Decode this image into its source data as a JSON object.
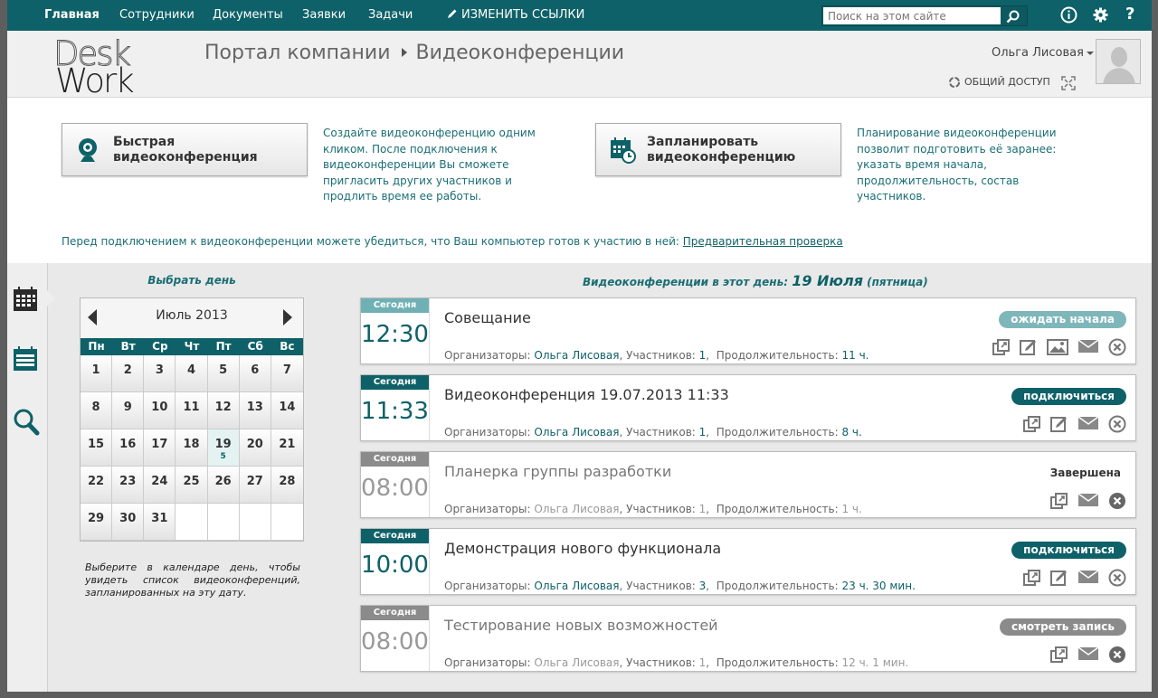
{
  "topnav": {
    "items": [
      "Главная",
      "Сотрудники",
      "Документы",
      "Заявки",
      "Задачи"
    ],
    "edit_links": "ИЗМЕНИТЬ ССЫЛКИ",
    "search_placeholder": "Поиск на этом сайте"
  },
  "header": {
    "logo_line1": "Desk",
    "logo_line2": "Work",
    "breadcrumb": [
      "Портал компании",
      "Видеоконференции"
    ],
    "user_name": "Ольга Лисовая",
    "share_label": "ОБЩИЙ ДОСТУП"
  },
  "actions": {
    "quick": {
      "label": "Быстрая видеоконференция",
      "description": "Создайте видеоконференцию одним кликом. После подключения к видеоконференции Вы сможете пригласить других участников и продлить время ее работы."
    },
    "schedule": {
      "label": "Запланировать видеоконференцию",
      "description": "Планирование видеоконференции позволит подготовить её заранее: указать время начала, продолжительность, состав участников."
    },
    "precheck_text": "Перед подключением к видеоконференции можете убедиться, что Ваш компьютер готов к участию в ней:",
    "precheck_link": "Предварительная проверка"
  },
  "calendar": {
    "title": "Выбрать день",
    "month": "Июль 2013",
    "weekdays": [
      "Пн",
      "Вт",
      "Ср",
      "Чт",
      "Пт",
      "Сб",
      "Вс"
    ],
    "days": [
      "1",
      "2",
      "3",
      "4",
      "5",
      "6",
      "7",
      "8",
      "9",
      "10",
      "11",
      "12",
      "13",
      "14",
      "15",
      "16",
      "17",
      "18",
      "19",
      "20",
      "21",
      "22",
      "23",
      "24",
      "25",
      "26",
      "27",
      "28",
      "29",
      "30",
      "31",
      "",
      "",
      "",
      ""
    ],
    "selected_day": "19",
    "selected_count": "5",
    "hint": "Выберите в календаре день, чтобы увидеть список видеоконференций, запланированных на эту дату."
  },
  "conferences": {
    "heading_prefix": "Видеоконференции в этот день:",
    "heading_date": "19 Июля",
    "heading_weekday": "(пятница)",
    "labels": {
      "organizers": "Организаторы:",
      "participants": "Участников:",
      "duration": "Продолжительность:"
    },
    "items": [
      {
        "tag": "Сегодня",
        "time": "12:30",
        "title": "Совещание",
        "organizer": "Ольга Лисовая",
        "participants": "1",
        "duration": "11 ч.",
        "status": "ожидать начала"
      },
      {
        "tag": "Сегодня",
        "time": "11:33",
        "title": "Видеоконференция 19.07.2013 11:33",
        "organizer": "Ольга Лисовая",
        "participants": "1",
        "duration": "8 ч.",
        "status": "подключиться"
      },
      {
        "tag": "Сегодня",
        "time": "08:00",
        "title": "Планерка группы разработки",
        "organizer": "Ольга Лисовая",
        "participants": "1",
        "duration": "1 ч.",
        "status": "Завершена"
      },
      {
        "tag": "Сегодня",
        "time": "10:00",
        "title": "Демонстрация нового функционала",
        "organizer": "Ольга Лисовая",
        "participants": "3",
        "duration": "23 ч. 30 мин.",
        "status": "подключиться"
      },
      {
        "tag": "Сегодня",
        "time": "08:00",
        "title": "Тестирование новых возможностей",
        "organizer": "Ольга Лисовая",
        "participants": "1",
        "duration": "12 ч. 1 мин.",
        "status": "смотреть запись"
      }
    ]
  },
  "colors": {
    "accent": "#0e6168",
    "accent_light": "#7fb6ba",
    "muted": "#8b8b8b"
  }
}
